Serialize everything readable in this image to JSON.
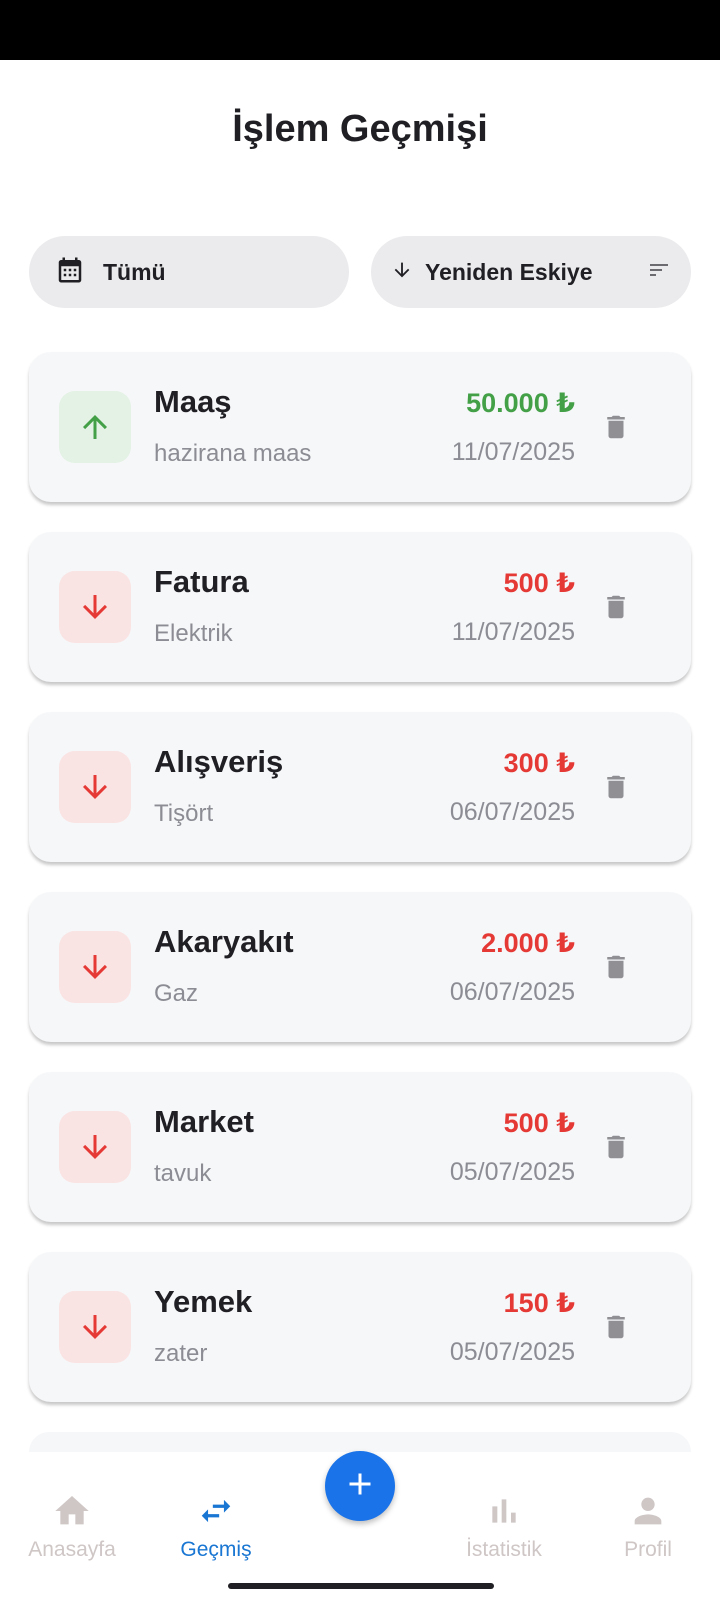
{
  "header": {
    "title": "İşlem Geçmişi"
  },
  "filters": {
    "date_label": "Tümü",
    "sort_label": "Yeniden Eskiye"
  },
  "transactions": [
    {
      "title": "Maaş",
      "note": "hazirana maas",
      "amount": "50.000 ₺",
      "date": "11/07/2025",
      "type": "income"
    },
    {
      "title": "Fatura",
      "note": "Elektrik",
      "amount": "500 ₺",
      "date": "11/07/2025",
      "type": "expense"
    },
    {
      "title": "Alışveriş",
      "note": "Tişört",
      "amount": "300 ₺",
      "date": "06/07/2025",
      "type": "expense"
    },
    {
      "title": "Akaryakıt",
      "note": "Gaz",
      "amount": "2.000 ₺",
      "date": "06/07/2025",
      "type": "expense"
    },
    {
      "title": "Market",
      "note": "tavuk",
      "amount": "500 ₺",
      "date": "05/07/2025",
      "type": "expense"
    },
    {
      "title": "Yemek",
      "note": "zater",
      "amount": "150 ₺",
      "date": "05/07/2025",
      "type": "expense"
    }
  ],
  "bottom_nav": {
    "home": "Anasayfa",
    "history": "Geçmiş",
    "stats": "İstatistik",
    "profile": "Profil"
  },
  "colors": {
    "income": "#43a047",
    "expense": "#e53935",
    "accent": "#1a73e8",
    "nav_active": "#1976d2",
    "nav_inactive": "#cfc6c6"
  },
  "icons": {
    "income": "arrow-up-icon",
    "expense": "arrow-down-icon",
    "delete": "trash-icon",
    "date_filter": "calendar-icon",
    "sort": "arrow-down-icon",
    "sort_menu": "sort-lines-icon",
    "fab": "plus-icon"
  }
}
